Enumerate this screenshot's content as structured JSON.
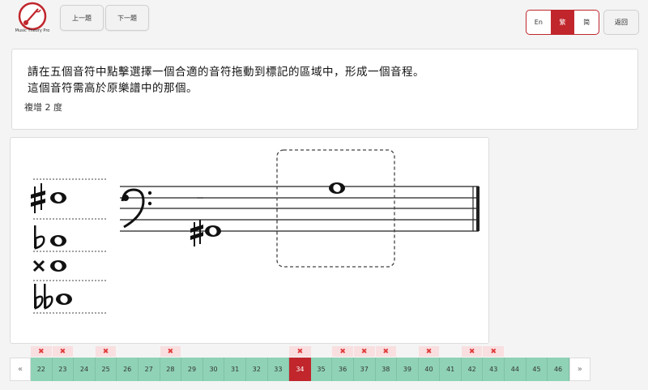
{
  "header": {
    "logo_caption": "Music Theory Pro",
    "prev_label": "上一題",
    "next_label": "下一題",
    "languages": [
      {
        "label": "En",
        "active": false
      },
      {
        "label": "繁",
        "active": true
      },
      {
        "label": "简",
        "active": false
      }
    ],
    "back_label": "返回"
  },
  "question": {
    "line1": "請在五個音符中點擊選擇一個合適的音符拖動到標記的區域中，形成一個音程。",
    "line2": "這個音符需高於原樂譜中的那個。",
    "interval": "複增 2 度"
  },
  "notation": {
    "clef": "bass",
    "given_note": "F#2 whole note",
    "placed_note": "E3 whole note",
    "accidental_choices": [
      "sharp",
      "flat",
      "double-sharp",
      "double-flat"
    ]
  },
  "pager": {
    "prev": "«",
    "next": "»",
    "pages": [
      {
        "n": "22",
        "wrong": true
      },
      {
        "n": "23",
        "wrong": true
      },
      {
        "n": "24",
        "wrong": false
      },
      {
        "n": "25",
        "wrong": true
      },
      {
        "n": "26",
        "wrong": false
      },
      {
        "n": "27",
        "wrong": false
      },
      {
        "n": "28",
        "wrong": true
      },
      {
        "n": "29",
        "wrong": false
      },
      {
        "n": "30",
        "wrong": false
      },
      {
        "n": "31",
        "wrong": false
      },
      {
        "n": "32",
        "wrong": false
      },
      {
        "n": "33",
        "wrong": false
      },
      {
        "n": "34",
        "wrong": true,
        "current": true
      },
      {
        "n": "35",
        "wrong": false
      },
      {
        "n": "36",
        "wrong": true
      },
      {
        "n": "37",
        "wrong": true
      },
      {
        "n": "38",
        "wrong": true
      },
      {
        "n": "39",
        "wrong": false
      },
      {
        "n": "40",
        "wrong": true
      },
      {
        "n": "41",
        "wrong": false
      },
      {
        "n": "42",
        "wrong": true
      },
      {
        "n": "43",
        "wrong": true
      },
      {
        "n": "44",
        "wrong": false
      },
      {
        "n": "45",
        "wrong": false
      },
      {
        "n": "46",
        "wrong": false
      }
    ],
    "wrong_symbol": "✖"
  }
}
